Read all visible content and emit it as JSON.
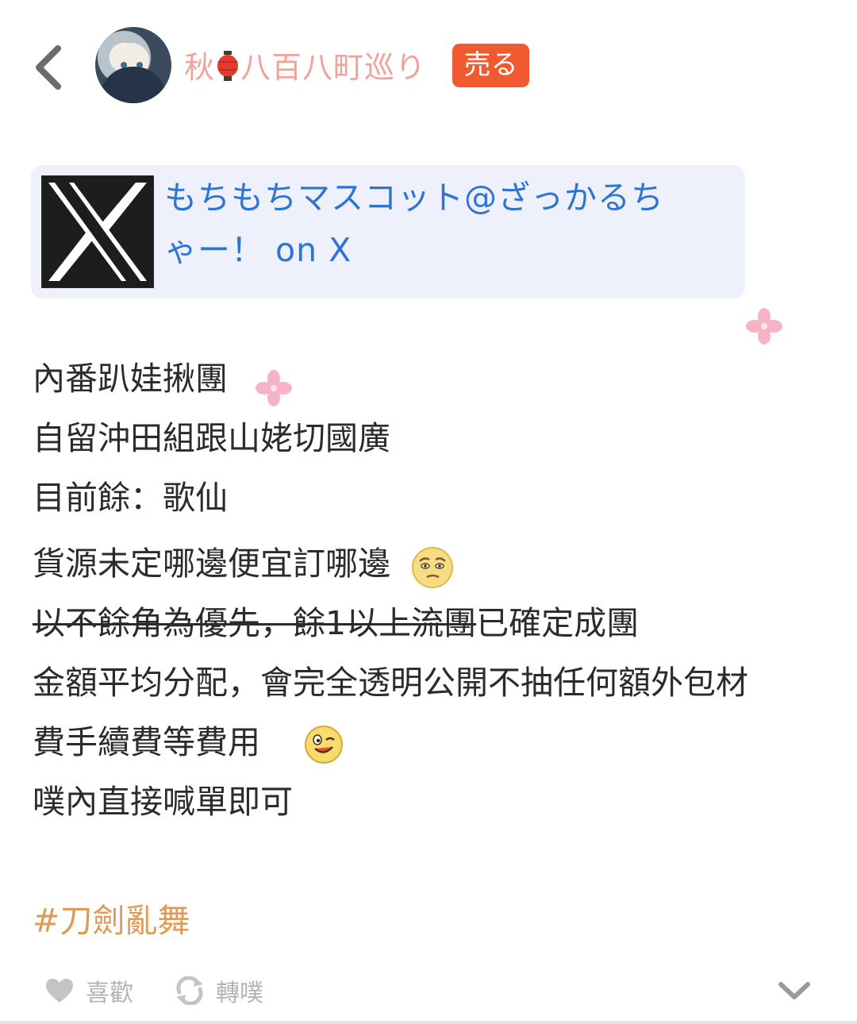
{
  "header": {
    "back_icon": "chevron-left-icon",
    "avatar_icon": "user-avatar",
    "username_before": "秋",
    "username_icon": "red-lantern-icon",
    "username_after": "八百八町巡り",
    "badge": "売る",
    "colors": {
      "username": "#f0a39a",
      "badge": "#f05a2e"
    }
  },
  "link_card": {
    "title": "もちもちマスコット@ざっかるちゃー！ on X",
    "icon": "x-logo-icon",
    "colors": {
      "background": "#eef1fb",
      "text": "#2e74d3"
    }
  },
  "post": {
    "lines": [
      "內番趴娃揪團",
      "自留沖田組跟山姥切國廣",
      "目前餘：歌仙"
    ],
    "line4": "貨源未定哪邊便宜訂哪邊",
    "line4_emoji": "skeptical-face-emoji",
    "line5_struck": "以不餘角為優先，餘1以上流團",
    "line5_rest": "已確定成團",
    "line6": "金額平均分配，會完全透明公開不抽任何額外包材",
    "line7": "費手續費等費用",
    "line7_emoji": "winking-face-emoji",
    "line8": "噗內直接喊單即可"
  },
  "hashtag": "#刀劍亂舞",
  "actions": {
    "like_label": "喜歡",
    "like_icon": "heart-icon",
    "replurk_label": "轉噗",
    "replurk_icon": "repost-icon",
    "more_icon": "chevron-down-icon"
  }
}
